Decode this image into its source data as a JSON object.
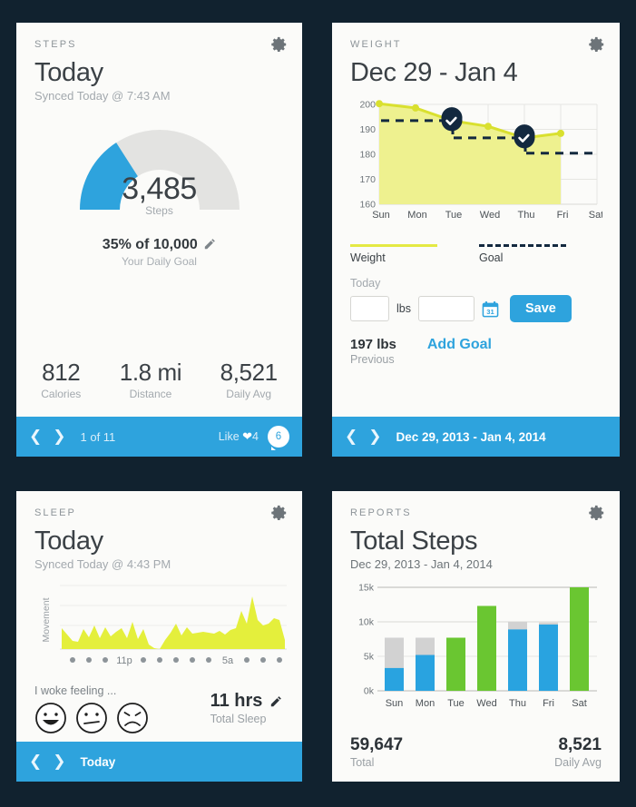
{
  "theme": {
    "background": "#11222f",
    "card_bg": "#fbfbf9",
    "accent_blue": "#2ea3dd",
    "chart_yellow": "#e4e944",
    "chart_green": "#6ac631",
    "navy": "#13293f",
    "gray_bar": "#d2d2d2"
  },
  "steps_card": {
    "kicker": "STEPS",
    "gear_icon": "gear-icon",
    "title": "Today",
    "subtitle": "Synced Today @ 7:43 AM",
    "gauge": {
      "value": "3,485",
      "unit_label": "Steps",
      "percent": 35,
      "goal_text": "35% of 10,000",
      "goal_sub": "Your Daily Goal",
      "edit_icon": "pencil-icon"
    },
    "stats": [
      {
        "value": "812",
        "label": "Calories"
      },
      {
        "value": "1.8 mi",
        "label": "Distance"
      },
      {
        "value": "8,521",
        "label": "Daily Avg"
      }
    ],
    "footer": {
      "prev_icon": "chevron-left-icon",
      "next_icon": "chevron-right-icon",
      "position": "1 of 11",
      "like_label": "Like",
      "heart_icon": "heart-icon",
      "like_count": "4",
      "comment_icon": "comment-bubble-icon",
      "comment_count": "6"
    }
  },
  "weight_card": {
    "kicker": "WEIGHT",
    "gear_icon": "gear-icon",
    "title": "Dec 29 - Jan 4",
    "legend": [
      {
        "label": "Weight",
        "style": "solid"
      },
      {
        "label": "Goal",
        "style": "dashed"
      }
    ],
    "form": {
      "today_label": "Today",
      "weight_value": "",
      "weight_placeholder": "",
      "unit": "lbs",
      "date_value": "",
      "date_placeholder": "",
      "calendar_icon": "calendar-icon",
      "save_label": "Save"
    },
    "previous": {
      "value": "197 lbs",
      "label": "Previous"
    },
    "add_goal_label": "Add Goal",
    "footer": {
      "prev_icon": "chevron-left-icon",
      "next_icon": "chevron-right-icon",
      "range": "Dec 29, 2013 - Jan 4, 2014"
    }
  },
  "sleep_card": {
    "kicker": "SLEEP",
    "gear_icon": "gear-icon",
    "title": "Today",
    "subtitle": "Synced Today @ 4:43 PM",
    "axis_label": "Movement",
    "tick_labels": [
      "11p",
      "5a"
    ],
    "woke_prompt": "I woke feeling ...",
    "faces": [
      "happy-face-icon",
      "neutral-face-icon",
      "sad-face-icon"
    ],
    "total": {
      "value": "11 hrs",
      "label": "Total Sleep",
      "edit_icon": "pencil-icon"
    },
    "footer": {
      "prev_icon": "chevron-left-icon",
      "next_icon": "chevron-right-icon",
      "range": "Today"
    }
  },
  "reports_card": {
    "kicker": "REPORTS",
    "gear_icon": "gear-icon",
    "title": "Total Steps",
    "subtitle": "Dec 29, 2013 - Jan 4, 2014",
    "totals": [
      {
        "value": "59,647",
        "label": "Total"
      },
      {
        "value": "8,521",
        "label": "Daily Avg"
      }
    ]
  },
  "chart_data": [
    {
      "id": "weight-line-chart",
      "type": "line",
      "title": "Dec 29 - Jan 4",
      "xlabel": "",
      "ylabel": "",
      "categories": [
        "Sun",
        "Mon",
        "Tue",
        "Wed",
        "Thu",
        "Fri",
        "Sat"
      ],
      "ylim": [
        160,
        200
      ],
      "yticks": [
        160,
        170,
        180,
        190,
        200
      ],
      "grid": true,
      "legend_position": "below",
      "series": [
        {
          "name": "Weight",
          "color": "#d9e02f",
          "fill": "#eef18f",
          "values": [
            200.3,
            198.6,
            193.5,
            191.2,
            186.6,
            188.4,
            null
          ]
        },
        {
          "name": "Goal",
          "color": "#13293f",
          "style": "dashed",
          "segments": [
            {
              "from_x": "Sun",
              "to_x": "Tue",
              "y": 193.5
            },
            {
              "from_x": "Tue",
              "to_x": "Thu",
              "y": 186.6
            },
            {
              "from_x": "Thu",
              "to_x": "Sat",
              "y": 180.5
            }
          ]
        }
      ],
      "markers": [
        {
          "x": "Tue",
          "y": 193.5,
          "icon": "check-badge-icon"
        },
        {
          "x": "Thu",
          "y": 186.6,
          "icon": "check-badge-icon"
        }
      ]
    },
    {
      "id": "sleep-movement-chart",
      "type": "area",
      "title": "",
      "ylabel": "Movement",
      "xlabel": "",
      "grid": true,
      "tick_labels": [
        "11p",
        "5a"
      ],
      "color": "#e4ef3c",
      "values": [
        32,
        22,
        14,
        12,
        30,
        18,
        34,
        20,
        33,
        22,
        27,
        31,
        20,
        38,
        18,
        30,
        10,
        6,
        5,
        16,
        24,
        35,
        22,
        32,
        24,
        25,
        26,
        25,
        24,
        27,
        23,
        28,
        30,
        52,
        38,
        72,
        40,
        34,
        36,
        42,
        40,
        18
      ]
    },
    {
      "id": "total-steps-bar-chart",
      "type": "bar",
      "title": "Total Steps",
      "subtitle": "Dec 29, 2013 - Jan 4, 2014",
      "categories": [
        "Sun",
        "Mon",
        "Tue",
        "Wed",
        "Thu",
        "Fri",
        "Sat"
      ],
      "ylim": [
        0,
        15000
      ],
      "yticks": [
        0,
        5000,
        10000,
        15000
      ],
      "ytick_labels": [
        "0k",
        "5k",
        "10k",
        "15k"
      ],
      "grid": true,
      "series": [
        {
          "name": "Steps",
          "values": [
            3300,
            5200,
            7700,
            12300,
            8900,
            9600,
            15000
          ],
          "colors": [
            "#29a3e0",
            "#29a3e0",
            "#6ac631",
            "#6ac631",
            "#29a3e0",
            "#29a3e0",
            "#6ac631"
          ]
        },
        {
          "name": "Goal remainder",
          "color": "#d2d2d2",
          "values": [
            7700,
            7700,
            0,
            0,
            10000,
            9900,
            0
          ]
        }
      ]
    }
  ]
}
